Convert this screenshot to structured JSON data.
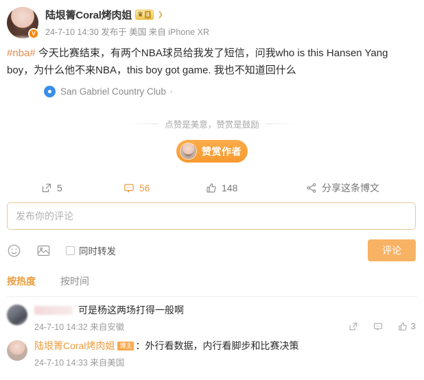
{
  "post": {
    "author": {
      "name": "陆垠箐Coral烤肉姐",
      "verified_badge": "V",
      "vip_level": "II",
      "crown_icon": "crown-icon"
    },
    "meta": "24-7-10 14:30 发布于 美国 来自 iPhone XR",
    "hashtag": "#nba#",
    "text": " 今天比赛结束，有两个NBA球员给我发了短信，问我who is this Hansen Yang boy，为什么他不来NBA，this boy got game. 我也不知道回什么",
    "location": "San Gabriel Country Club",
    "location_caret": "›"
  },
  "reward": {
    "tip_text": "点赞是美意，赞赏是鼓励",
    "button_label": "赞赏作者"
  },
  "actions": {
    "repost_count": "5",
    "comment_count": "56",
    "like_count": "148",
    "share_label": "分享这条博文"
  },
  "composer": {
    "placeholder": "发布你的评论",
    "repost_checkbox_label": "同时转发",
    "submit_label": "评论"
  },
  "sort": {
    "by_hot": "按热度",
    "by_time": "按时间"
  },
  "comments": [
    {
      "user": "",
      "is_author": false,
      "text": "可是杨这两场打得一般啊",
      "meta": "24-7-10 14:32 来自安徽",
      "like_count": "3"
    },
    {
      "user": "陆垠箐Coral烤肉姐",
      "is_author": true,
      "badge": "博主",
      "text": "：外行看数据，内行看脚步和比赛决策",
      "meta": "24-7-10 14:33 来自美国",
      "like_count": ""
    }
  ],
  "colors": {
    "accent": "#eb9b3c",
    "button": "#f7b264",
    "location_pin": "#3b8ee8",
    "verified": "#ff8200"
  }
}
